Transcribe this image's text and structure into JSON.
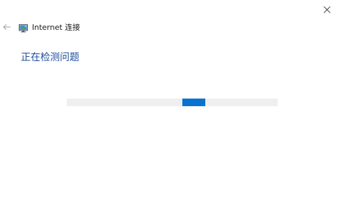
{
  "window": {
    "title": "Internet 连接",
    "close_icon": "close-icon",
    "back_icon": "back-arrow-icon",
    "app_icon": "network-troubleshooter-icon"
  },
  "main": {
    "status": "正在检测问题",
    "progress": {
      "type": "indeterminate",
      "indicator_start_fraction": 0.548,
      "indicator_width_fraction": 0.109,
      "track_color": "#efefef",
      "indicator_color": "#0a73d1"
    }
  },
  "colors": {
    "accent": "#1f4e9b",
    "progress": "#0a73d1"
  }
}
